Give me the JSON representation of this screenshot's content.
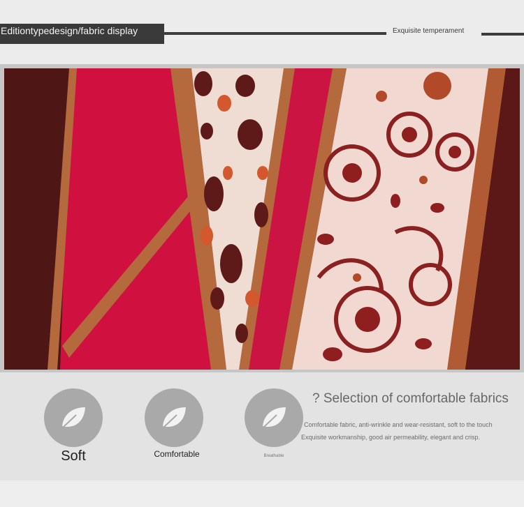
{
  "header": {
    "title": "Editiontypedesign/fabric display",
    "tagline": "Exquisite temperament"
  },
  "photo": {
    "subject": "printed fabric close-up",
    "colors": {
      "red": "#d0103f",
      "tan_stripe": "#b56a3e",
      "maroon": "#5b1515",
      "cream": "#f0d8cf",
      "rust": "#b04a2a"
    }
  },
  "features": {
    "items": [
      {
        "label": "Soft",
        "icon": "leaf-icon"
      },
      {
        "label": "Comfortable",
        "icon": "leaf-icon"
      },
      {
        "label": "Breathable",
        "icon": "leaf-icon"
      }
    ],
    "heading": "? Selection of comfortable fabrics",
    "desc1": "Comfortable fabric, anti-wrinkle and wear-resistant, soft to the touch",
    "desc2": "Exquisite workmanship, good air permeability, elegant and crisp."
  }
}
